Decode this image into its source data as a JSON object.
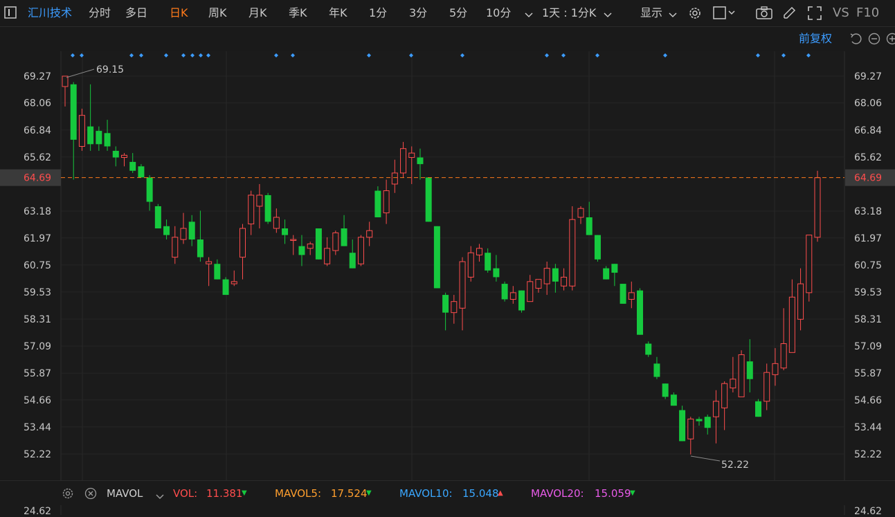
{
  "topbar": {
    "stock_name": "汇川技术",
    "periods": [
      "分时",
      "多日",
      "日K",
      "周K",
      "月K",
      "季K",
      "年K",
      "1分",
      "3分",
      "5分",
      "10分"
    ],
    "active_period": "日K",
    "interval_select": "1天 : 1分K",
    "display_label": "显示",
    "vs_label": "VS",
    "f10_label": "F10"
  },
  "subbar": {
    "adjust_label": "前复权"
  },
  "colors": {
    "up": "#ff4d4d",
    "down": "#16c93e",
    "last_price": "#ff7a1a",
    "marker": "#3c9cff"
  },
  "chart_data": {
    "type": "candlestick",
    "y_ticks": [
      69.27,
      68.06,
      66.84,
      65.62,
      63.18,
      61.97,
      60.75,
      59.53,
      58.31,
      57.09,
      55.87,
      54.66,
      53.44,
      52.22
    ],
    "ylim": [
      51.1,
      70.6
    ],
    "last_price": 64.69,
    "last_price_label": "64.69",
    "max_label": "69.15",
    "min_label": "52.22",
    "candles": [
      {
        "o": 68.8,
        "h": 69.15,
        "l": 67.9,
        "c": 69.27
      },
      {
        "o": 68.9,
        "h": 69.0,
        "l": 64.6,
        "c": 66.4
      },
      {
        "o": 66.1,
        "h": 67.8,
        "l": 65.9,
        "c": 67.5
      },
      {
        "o": 67.0,
        "h": 68.9,
        "l": 65.9,
        "c": 66.2
      },
      {
        "o": 66.8,
        "h": 67.0,
        "l": 65.9,
        "c": 66.2
      },
      {
        "o": 66.7,
        "h": 67.3,
        "l": 65.9,
        "c": 66.1
      },
      {
        "o": 65.9,
        "h": 66.1,
        "l": 65.2,
        "c": 65.6
      },
      {
        "o": 65.6,
        "h": 65.8,
        "l": 65.2,
        "c": 65.7
      },
      {
        "o": 65.4,
        "h": 65.8,
        "l": 64.9,
        "c": 65.0
      },
      {
        "o": 65.2,
        "h": 65.3,
        "l": 64.7,
        "c": 64.7
      },
      {
        "o": 64.7,
        "h": 64.8,
        "l": 63.2,
        "c": 63.6
      },
      {
        "o": 63.4,
        "h": 63.5,
        "l": 62.4,
        "c": 62.4
      },
      {
        "o": 62.5,
        "h": 62.8,
        "l": 61.9,
        "c": 62.1
      },
      {
        "o": 61.1,
        "h": 62.5,
        "l": 60.8,
        "c": 62.0
      },
      {
        "o": 61.9,
        "h": 63.1,
        "l": 61.7,
        "c": 62.4
      },
      {
        "o": 62.7,
        "h": 63.0,
        "l": 61.6,
        "c": 61.9
      },
      {
        "o": 61.9,
        "h": 63.2,
        "l": 60.9,
        "c": 61.1
      },
      {
        "o": 60.8,
        "h": 61.1,
        "l": 59.8,
        "c": 60.9
      },
      {
        "o": 60.8,
        "h": 61.0,
        "l": 60.1,
        "c": 60.1
      },
      {
        "o": 60.1,
        "h": 60.2,
        "l": 59.4,
        "c": 59.4
      },
      {
        "o": 59.9,
        "h": 60.5,
        "l": 59.8,
        "c": 60.0
      },
      {
        "o": 61.1,
        "h": 62.6,
        "l": 60.1,
        "c": 62.4
      },
      {
        "o": 62.6,
        "h": 64.1,
        "l": 62.1,
        "c": 63.9
      },
      {
        "o": 63.4,
        "h": 64.4,
        "l": 62.4,
        "c": 63.9
      },
      {
        "o": 63.9,
        "h": 64.0,
        "l": 62.6,
        "c": 62.7
      },
      {
        "o": 62.4,
        "h": 63.3,
        "l": 62.2,
        "c": 62.9
      },
      {
        "o": 62.4,
        "h": 62.8,
        "l": 61.7,
        "c": 62.1
      },
      {
        "o": 61.9,
        "h": 62.1,
        "l": 61.2,
        "c": 61.9
      },
      {
        "o": 61.6,
        "h": 62.1,
        "l": 60.7,
        "c": 61.2
      },
      {
        "o": 61.5,
        "h": 61.8,
        "l": 61.2,
        "c": 61.7
      },
      {
        "o": 62.4,
        "h": 62.4,
        "l": 61.0,
        "c": 61.0
      },
      {
        "o": 60.8,
        "h": 62.0,
        "l": 60.7,
        "c": 61.5
      },
      {
        "o": 61.4,
        "h": 62.3,
        "l": 61.2,
        "c": 62.2
      },
      {
        "o": 62.4,
        "h": 63.0,
        "l": 61.7,
        "c": 61.6
      },
      {
        "o": 61.3,
        "h": 61.9,
        "l": 60.7,
        "c": 60.6
      },
      {
        "o": 60.8,
        "h": 62.1,
        "l": 60.7,
        "c": 62.0
      },
      {
        "o": 62.0,
        "h": 62.7,
        "l": 61.6,
        "c": 62.3
      },
      {
        "o": 64.1,
        "h": 64.3,
        "l": 63.2,
        "c": 62.9
      },
      {
        "o": 63.1,
        "h": 64.6,
        "l": 62.6,
        "c": 64.1
      },
      {
        "o": 64.4,
        "h": 65.5,
        "l": 64.0,
        "c": 64.9
      },
      {
        "o": 64.9,
        "h": 66.3,
        "l": 64.7,
        "c": 66.0
      },
      {
        "o": 65.6,
        "h": 66.1,
        "l": 64.4,
        "c": 65.8
      },
      {
        "o": 65.6,
        "h": 66.0,
        "l": 64.6,
        "c": 65.3
      },
      {
        "o": 64.7,
        "h": 64.7,
        "l": 62.7,
        "c": 62.7
      },
      {
        "o": 62.5,
        "h": 62.5,
        "l": 59.7,
        "c": 59.7
      },
      {
        "o": 59.4,
        "h": 59.5,
        "l": 57.8,
        "c": 58.6
      },
      {
        "o": 58.6,
        "h": 59.4,
        "l": 58.1,
        "c": 59.1
      },
      {
        "o": 58.8,
        "h": 61.1,
        "l": 57.8,
        "c": 60.9
      },
      {
        "o": 60.2,
        "h": 61.6,
        "l": 60.0,
        "c": 61.3
      },
      {
        "o": 61.2,
        "h": 61.7,
        "l": 60.9,
        "c": 61.5
      },
      {
        "o": 61.3,
        "h": 61.5,
        "l": 60.4,
        "c": 60.5
      },
      {
        "o": 60.6,
        "h": 61.2,
        "l": 60.0,
        "c": 60.2
      },
      {
        "o": 59.9,
        "h": 60.0,
        "l": 59.1,
        "c": 59.2
      },
      {
        "o": 59.2,
        "h": 59.8,
        "l": 59.0,
        "c": 59.5
      },
      {
        "o": 59.6,
        "h": 59.6,
        "l": 58.6,
        "c": 58.7
      },
      {
        "o": 59.1,
        "h": 60.3,
        "l": 59.1,
        "c": 60.0
      },
      {
        "o": 59.7,
        "h": 60.1,
        "l": 59.5,
        "c": 60.1
      },
      {
        "o": 59.9,
        "h": 60.9,
        "l": 59.4,
        "c": 60.6
      },
      {
        "o": 60.6,
        "h": 60.8,
        "l": 59.5,
        "c": 60.0
      },
      {
        "o": 59.8,
        "h": 60.6,
        "l": 59.6,
        "c": 60.2
      },
      {
        "o": 59.8,
        "h": 63.4,
        "l": 59.6,
        "c": 62.8
      },
      {
        "o": 62.9,
        "h": 63.4,
        "l": 62.6,
        "c": 63.3
      },
      {
        "o": 62.9,
        "h": 63.6,
        "l": 62.1,
        "c": 62.1
      },
      {
        "o": 62.1,
        "h": 62.1,
        "l": 60.9,
        "c": 61.0
      },
      {
        "o": 60.6,
        "h": 60.7,
        "l": 60.1,
        "c": 60.1
      },
      {
        "o": 60.8,
        "h": 60.6,
        "l": 59.8,
        "c": 60.4
      },
      {
        "o": 59.9,
        "h": 59.9,
        "l": 59.0,
        "c": 59.0
      },
      {
        "o": 59.2,
        "h": 60.0,
        "l": 58.8,
        "c": 59.5
      },
      {
        "o": 59.6,
        "h": 59.7,
        "l": 57.6,
        "c": 57.6
      },
      {
        "o": 57.2,
        "h": 57.3,
        "l": 56.6,
        "c": 56.7
      },
      {
        "o": 56.3,
        "h": 56.6,
        "l": 55.6,
        "c": 55.7
      },
      {
        "o": 55.4,
        "h": 55.4,
        "l": 54.7,
        "c": 54.8
      },
      {
        "o": 54.9,
        "h": 55.0,
        "l": 54.4,
        "c": 54.4
      },
      {
        "o": 54.2,
        "h": 54.4,
        "l": 52.8,
        "c": 52.8
      },
      {
        "o": 52.9,
        "h": 53.9,
        "l": 52.2,
        "c": 53.8
      },
      {
        "o": 53.8,
        "h": 53.9,
        "l": 53.5,
        "c": 53.7
      },
      {
        "o": 53.9,
        "h": 54.0,
        "l": 53.1,
        "c": 53.4
      },
      {
        "o": 53.9,
        "h": 55.1,
        "l": 52.7,
        "c": 54.6
      },
      {
        "o": 54.3,
        "h": 55.5,
        "l": 53.3,
        "c": 55.4
      },
      {
        "o": 55.2,
        "h": 56.6,
        "l": 55.0,
        "c": 55.6
      },
      {
        "o": 54.8,
        "h": 56.9,
        "l": 54.8,
        "c": 56.7
      },
      {
        "o": 56.4,
        "h": 57.4,
        "l": 55.0,
        "c": 55.6
      },
      {
        "o": 54.6,
        "h": 54.7,
        "l": 53.9,
        "c": 53.9
      },
      {
        "o": 54.6,
        "h": 56.3,
        "l": 54.2,
        "c": 55.9
      },
      {
        "o": 55.8,
        "h": 57.0,
        "l": 55.3,
        "c": 56.3
      },
      {
        "o": 56.1,
        "h": 58.8,
        "l": 56.0,
        "c": 57.2
      },
      {
        "o": 56.8,
        "h": 60.1,
        "l": 56.9,
        "c": 59.3
      },
      {
        "o": 58.3,
        "h": 60.6,
        "l": 57.8,
        "c": 59.9
      },
      {
        "o": 59.5,
        "h": 60.8,
        "l": 59.1,
        "c": 62.1
      },
      {
        "o": 62.0,
        "h": 65.0,
        "l": 61.8,
        "c": 64.69
      }
    ],
    "marker_xs": [
      105,
      118,
      190,
      204,
      240,
      265,
      278,
      290,
      301,
      399,
      423,
      533,
      594,
      668,
      790,
      814,
      863,
      961,
      1095,
      1132,
      1168
    ]
  },
  "volume_indicator": {
    "name": "MAVOL",
    "items": [
      {
        "label": "VOL:",
        "value": "11.381",
        "color": "#ff4d4d",
        "arrow": "down"
      },
      {
        "label": "MAVOL5:",
        "value": "17.524",
        "color": "#ff9f2e",
        "arrow": "down"
      },
      {
        "label": "MAVOL10:",
        "value": "15.048",
        "color": "#3aa7ff",
        "arrow": "up"
      },
      {
        "label": "MAVOL20:",
        "value": "15.059",
        "color": "#e95be9",
        "arrow": "down"
      }
    ],
    "volume_axis_top": "24.62"
  }
}
